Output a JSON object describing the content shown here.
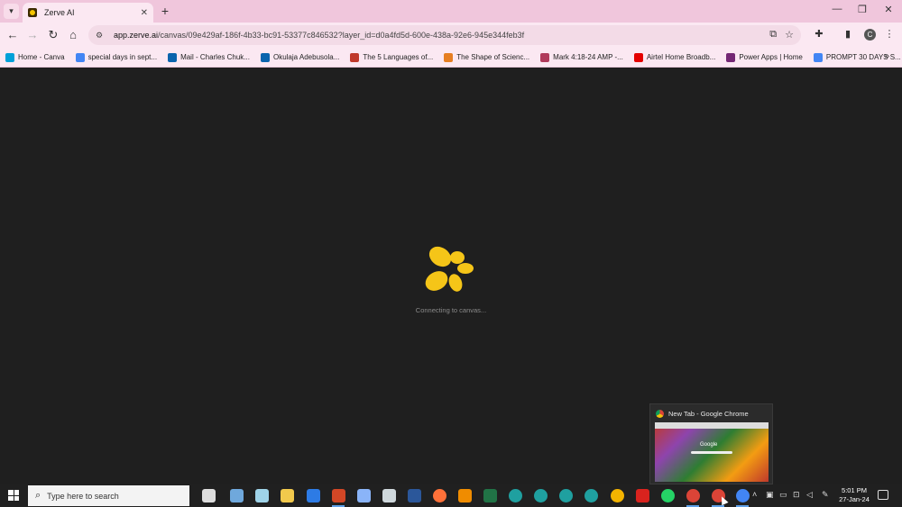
{
  "browser": {
    "tab": {
      "title": "Zerve AI",
      "favicon": "zerve-icon"
    },
    "url": {
      "host": "app.zerve.ai",
      "path": "/canvas/09e429af-186f-4b33-bc91-53377c846532?layer_id=d0a4fd5d-600e-438a-92e6-945e344feb3f"
    },
    "bookmarks": [
      {
        "label": "Home - Canva",
        "icon": "canva-icon",
        "color": "#00a0d8"
      },
      {
        "label": "special days in sept...",
        "icon": "google-icon",
        "color": "#4285f4"
      },
      {
        "label": "Mail - Charles Chuk...",
        "icon": "outlook-icon",
        "color": "#0a64ad"
      },
      {
        "label": "Okulaja Adebusola...",
        "icon": "outlook-icon",
        "color": "#0a64ad"
      },
      {
        "label": "The 5 Languages of...",
        "icon": "red-book-icon",
        "color": "#c0392b"
      },
      {
        "label": "The Shape of Scienc...",
        "icon": "orange-icon",
        "color": "#e67e22"
      },
      {
        "label": "Mark 4:18-24 AMP -...",
        "icon": "headset-icon",
        "color": "#b03a5b"
      },
      {
        "label": "Airtel Home Broadb...",
        "icon": "airtel-icon",
        "color": "#e40000"
      },
      {
        "label": "Power Apps | Home",
        "icon": "powerapps-icon",
        "color": "#742774"
      },
      {
        "label": "PROMPT 30 DAYS S...",
        "icon": "docs-icon",
        "color": "#4285f4"
      }
    ]
  },
  "canvas": {
    "loading_text": "Connecting to canvas...",
    "logo_color": "#f5c518"
  },
  "preview": {
    "title": "New Tab - Google Chrome",
    "thumb_text": "Google"
  },
  "taskbar": {
    "search_placeholder": "Type here to search",
    "time": "5:01 PM",
    "date": "27-Jan-24"
  }
}
